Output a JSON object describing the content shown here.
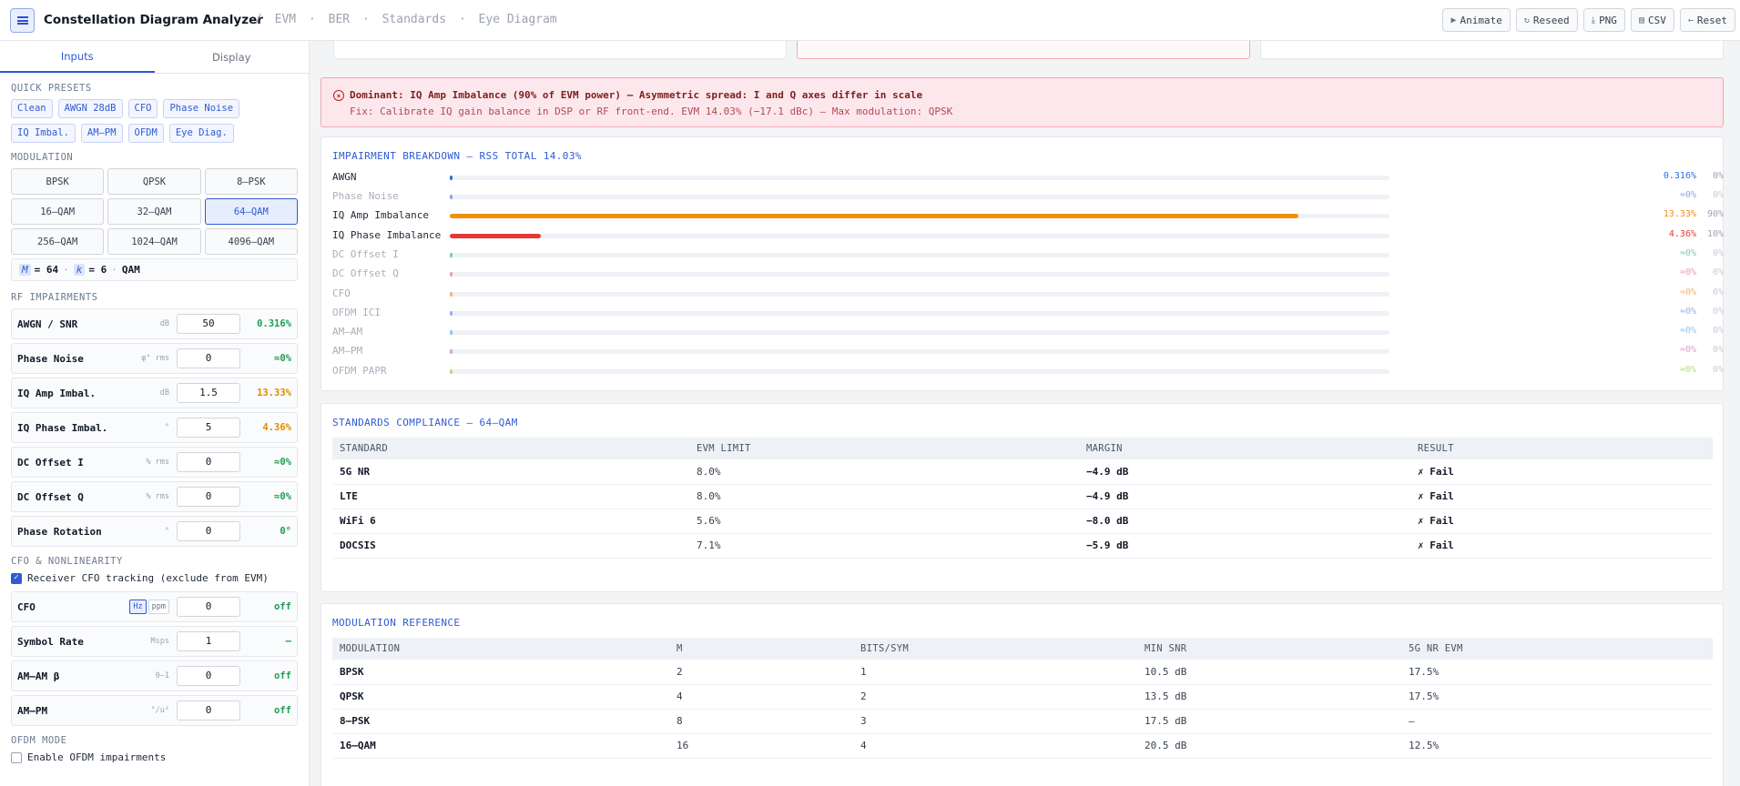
{
  "header": {
    "title": "Constellation Diagram Analyzer",
    "breadcrumb_sep": "/",
    "crumbs": [
      "EVM",
      "BER",
      "Standards",
      "Eye Diagram"
    ],
    "crumb_dot": "·",
    "actions": {
      "animate": "Animate",
      "reseed": "Reseed",
      "png": "PNG",
      "csv": "CSV",
      "reset": "Reset"
    }
  },
  "sidebar": {
    "tabs": [
      "Inputs",
      "Display"
    ],
    "presets_label": "QUICK PRESETS",
    "presets": [
      "Clean",
      "AWGN 28dB",
      "CFO",
      "Phase Noise",
      "IQ Imbal.",
      "AM–PM",
      "OFDM",
      "Eye Diag."
    ],
    "modulation_label": "MODULATION",
    "modulations": [
      "BPSK",
      "QPSK",
      "8–PSK",
      "16–QAM",
      "32–QAM",
      "64–QAM",
      "256–QAM",
      "1024–QAM",
      "4096–QAM"
    ],
    "selected_modulation": "64–QAM",
    "mk": {
      "m_sym": "M",
      "m_val": "= 64",
      "dot": "·",
      "k_sym": "k",
      "k_val": "= 6",
      "dot2": "·",
      "family": "QAM"
    },
    "rf_label": "RF IMPAIRMENTS",
    "rf_params": [
      {
        "name": "AWGN / SNR",
        "unit": "dB",
        "value": "50",
        "result": "0.316%",
        "color": "green"
      },
      {
        "name": "Phase Noise",
        "unit": "φ° rms",
        "value": "0",
        "result": "≈0%",
        "color": "green"
      },
      {
        "name": "IQ Amp Imbal.",
        "unit": "dB",
        "value": "1.5",
        "result": "13.33%",
        "color": "orange"
      },
      {
        "name": "IQ Phase Imbal.",
        "unit": "°",
        "value": "5",
        "result": "4.36%",
        "color": "orange"
      },
      {
        "name": "DC Offset I",
        "unit": "% rms",
        "value": "0",
        "result": "≈0%",
        "color": "green"
      },
      {
        "name": "DC Offset Q",
        "unit": "% rms",
        "value": "0",
        "result": "≈0%",
        "color": "green"
      },
      {
        "name": "Phase Rotation",
        "unit": "°",
        "value": "0",
        "result": "0°",
        "color": "green"
      }
    ],
    "cfo_label": "CFO & NONLINEARITY",
    "cfo_tracking": {
      "label": "Receiver CFO tracking (exclude from EVM)",
      "checked": true
    },
    "cfo": {
      "name": "CFO",
      "unit_hz": "Hz",
      "unit_ppm": "ppm",
      "value": "0",
      "result": "off"
    },
    "nl_params": [
      {
        "name": "Symbol Rate",
        "unit": "Msps",
        "value": "1",
        "result": "—",
        "color": "green"
      },
      {
        "name": "AM–AM β",
        "unit": "0–1",
        "value": "0",
        "result": "off",
        "color": "green"
      },
      {
        "name": "AM–PM",
        "unit": "°/u²",
        "value": "0",
        "result": "off",
        "color": "green"
      }
    ],
    "ofdm_label": "OFDM MODE",
    "ofdm_enable": {
      "label": "Enable OFDM impairments",
      "checked": false
    }
  },
  "alert": {
    "title": "Dominant: IQ Amp Imbalance (90% of EVM power) — Asymmetric spread: I and Q axes differ in scale",
    "detail": "Fix: Calibrate IQ gain balance in DSP or RF front-end. EVM 14.03% (−17.1 dBc) — Max modulation: QPSK"
  },
  "breakdown": {
    "title": "IMPAIRMENT BREAKDOWN — RSS TOTAL 14.03%",
    "rows": [
      {
        "name": "AWGN",
        "value": "0.316%",
        "pct": "0%",
        "fill": 0.003,
        "color": "#2f6fdc",
        "dim": false
      },
      {
        "name": "Phase Noise",
        "value": "≈0%",
        "pct": "0%",
        "fill": 0,
        "color": "#8da6e8",
        "dim": true
      },
      {
        "name": "IQ Amp Imbalance",
        "value": "13.33%",
        "pct": "90%",
        "fill": 0.903,
        "color": "#f0900c",
        "dim": false
      },
      {
        "name": "IQ Phase Imbalance",
        "value": "4.36%",
        "pct": "10%",
        "fill": 0.097,
        "color": "#e53935",
        "dim": false
      },
      {
        "name": "DC Offset I",
        "value": "≈0%",
        "pct": "0%",
        "fill": 0,
        "color": "#7fcfa4",
        "dim": true
      },
      {
        "name": "DC Offset Q",
        "value": "≈0%",
        "pct": "0%",
        "fill": 0,
        "color": "#f29ab0",
        "dim": true
      },
      {
        "name": "CFO",
        "value": "≈0%",
        "pct": "0%",
        "fill": 0,
        "color": "#f5b27a",
        "dim": true
      },
      {
        "name": "OFDM ICI",
        "value": "≈0%",
        "pct": "0%",
        "fill": 0,
        "color": "#9ab0f0",
        "dim": true
      },
      {
        "name": "AM–AM",
        "value": "≈0%",
        "pct": "0%",
        "fill": 0,
        "color": "#8ec7f2",
        "dim": true
      },
      {
        "name": "AM–PM",
        "value": "≈0%",
        "pct": "0%",
        "fill": 0,
        "color": "#e79ae0",
        "dim": true
      },
      {
        "name": "OFDM PAPR",
        "value": "≈0%",
        "pct": "0%",
        "fill": 0,
        "color": "#b8dd7c",
        "dim": true
      }
    ]
  },
  "standards": {
    "title": "STANDARDS COMPLIANCE — 64–QAM",
    "headers": [
      "STANDARD",
      "EVM LIMIT",
      "MARGIN",
      "RESULT"
    ],
    "rows": [
      [
        "5G NR",
        "8.0%",
        "−4.9 dB",
        "✗ Fail"
      ],
      [
        "LTE",
        "8.0%",
        "−4.9 dB",
        "✗ Fail"
      ],
      [
        "WiFi 6",
        "5.6%",
        "−8.0 dB",
        "✗ Fail"
      ],
      [
        "DOCSIS",
        "7.1%",
        "−5.9 dB",
        "✗ Fail"
      ]
    ]
  },
  "modref": {
    "title": "MODULATION REFERENCE",
    "headers": [
      "MODULATION",
      "M",
      "BITS/SYM",
      "MIN SNR",
      "5G NR EVM"
    ],
    "rows": [
      [
        "BPSK",
        "2",
        "1",
        "10.5 dB",
        "17.5%"
      ],
      [
        "QPSK",
        "4",
        "2",
        "13.5 dB",
        "17.5%"
      ],
      [
        "8–PSK",
        "8",
        "3",
        "17.5 dB",
        "—"
      ],
      [
        "16–QAM",
        "16",
        "4",
        "20.5 dB",
        "12.5%"
      ]
    ]
  }
}
